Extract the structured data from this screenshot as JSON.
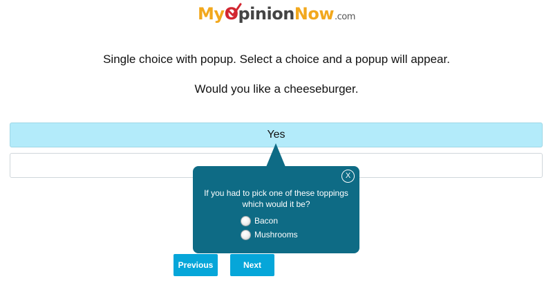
{
  "logo": {
    "part_my": "My",
    "part_o": "O",
    "part_pinion": "pinion",
    "part_now": "Now",
    "part_com": ".com",
    "colors": {
      "orange": "#f2a81d",
      "red": "#d22630",
      "gray": "#444444"
    }
  },
  "instruction": "Single choice with popup. Select a choice and a popup will appear.",
  "question": "Would you like a cheeseburger.",
  "choices": [
    {
      "label": "Yes",
      "selected": true
    },
    {
      "label": "",
      "selected": false
    }
  ],
  "popup": {
    "close_label": "X",
    "question": "If you had to pick one of these toppings which would it be?",
    "options": [
      {
        "label": "Bacon",
        "selected": false
      },
      {
        "label": "Mushrooms",
        "selected": false
      }
    ],
    "color": "#0e6b85"
  },
  "nav": {
    "previous_label": "Previous",
    "next_label": "Next",
    "color": "#06a6d9"
  },
  "colors": {
    "selected_choice_bg": "#b3ebfa"
  }
}
